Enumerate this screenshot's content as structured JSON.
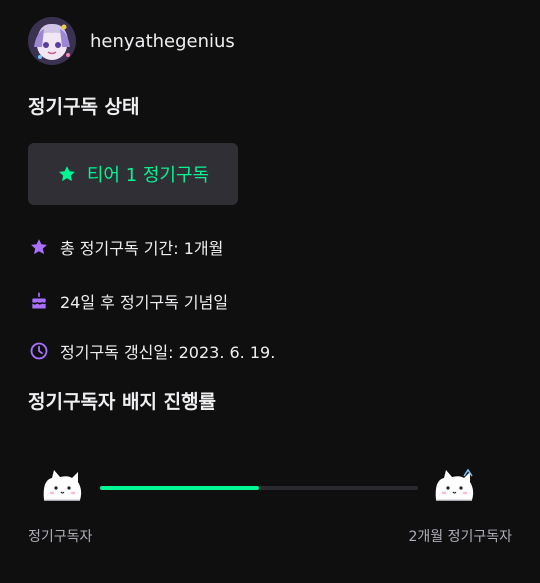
{
  "user": {
    "username": "henyathegenius"
  },
  "status": {
    "title": "정기구독 상태",
    "tier_label": "티어 1 정기구독",
    "total_duration": "총 정기구독 기간: 1개월",
    "anniversary": "24일 후 정기구독 기념일",
    "renewal": "정기구독 갱신일: 2023. 6. 19."
  },
  "badge_progress": {
    "title": "정기구독자 배지 진행률",
    "progress": 0.5,
    "start_label": "정기구독자",
    "end_label": "2개월 정기구독자"
  },
  "colors": {
    "accent_green": "#00f593",
    "icon_purple": "#a970ff",
    "background": "#0f0f10"
  },
  "icons": {
    "tier": "star-icon",
    "total_duration": "star-icon",
    "anniversary": "cake-icon",
    "renewal": "clock-icon",
    "badge_start": "cat-icon",
    "badge_end": "cat-icon"
  }
}
